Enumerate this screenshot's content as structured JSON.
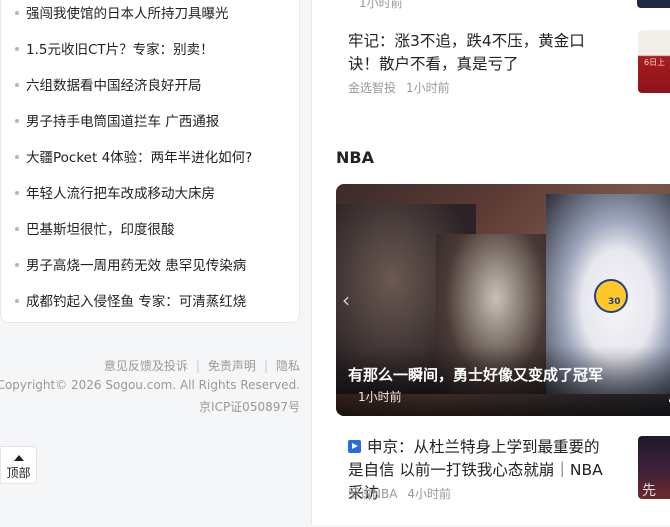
{
  "left": {
    "hot_items": [
      "强闯我使馆的日本人所持刀具曝光",
      "1.5元收旧CT片？专家：别卖！",
      "六组数据看中国经济良好开局",
      "男子持手电筒国道拦车 广西通报",
      "大疆Pocket 4体验：两年半进化如何?",
      "年轻人流行把车改成移动大床房",
      "巴基斯坦很忙，印度很酸",
      "男子高烧一周用药无效 患罕见传染病",
      "成都钓起入侵怪鱼 专家：可清蒸红烧"
    ],
    "footer": {
      "feedback": "意见反馈及投诉",
      "disclaimer": "免责声明",
      "privacy": "隐私",
      "copyright": "Copyright© 2026 Sogou.com. All Rights Reserved.",
      "icp": "京ICP证050897号"
    },
    "back_to_top": "顶部"
  },
  "right": {
    "top_time_fragment": "1小时前",
    "news1": {
      "title": "牢记：涨3不追，跌4不压，黄金口诀！散户不看，真是亏了",
      "source": "金选智投",
      "time": "1小时前",
      "thumb_text": "6日上"
    },
    "section_title": "NBA",
    "hero": {
      "caption": "有那么一瞬间，勇士好像又变成了冠军",
      "time": "1小时前",
      "jersey_number": "30",
      "arrow": "‹"
    },
    "news3": {
      "title": "申京：从杜兰特身上学到最重要的是自信 以前一打铁我心态就崩｜NBA采访",
      "source": "罗说NBA",
      "time": "4小时前",
      "thumb_text": "先"
    },
    "bottom_fragment": "..."
  },
  "colors": {
    "meta_gray": "#999999",
    "video_icon_blue": "#2a6ae0",
    "page_bg": "#f5f6f8"
  }
}
